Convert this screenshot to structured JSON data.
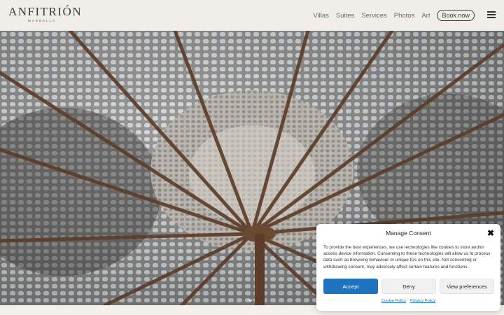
{
  "header": {
    "logo_main": "ANFITRIÓN",
    "logo_sub": "MARBELLA",
    "nav": [
      "Villas",
      "Suites",
      "Services",
      "Photos",
      "Art"
    ],
    "book_label": "Book now",
    "menu_icon": "hamburger-icon"
  },
  "hero": {
    "image": "macrame-umbrella-photo",
    "scroll_icon": "chevron-down-icon",
    "scroll_glyph": "⌄"
  },
  "consent": {
    "title": "Manage Consent",
    "close_glyph": "✖",
    "text": "To provide the best experiences, we use technologies like cookies to store and/or access device information. Consenting to these technologies will allow us to process data such as browsing behaviour or unique IDs on this site. Not consenting or withdrawing consent, may adversely affect certain features and functions.",
    "accept_label": "Accept",
    "deny_label": "Deny",
    "prefs_label": "View preferences",
    "cookie_policy": "Cookie Policy",
    "privacy_policy": "Privacy Policy",
    "accent_color": "#1e73be"
  }
}
